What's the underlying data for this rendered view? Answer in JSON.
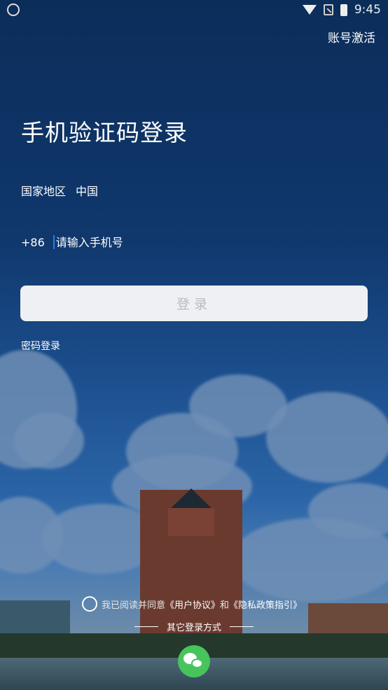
{
  "status_bar": {
    "time": "9:45"
  },
  "header": {
    "activate_label": "账号激活"
  },
  "main": {
    "title": "手机验证码登录",
    "region_label": "国家地区",
    "region_value": "中国",
    "country_code": "+86",
    "phone_placeholder": "请输入手机号",
    "login_button_label": "登录",
    "password_login_label": "密码登录"
  },
  "footer": {
    "agreement_prefix": "我已阅读并同意",
    "user_agreement": "《用户协议》",
    "and_text": "和",
    "privacy_policy": "《隐私政策指引》",
    "other_login_label": "其它登录方式"
  },
  "colors": {
    "wechat": "#47c45b",
    "button_bg": "#eef0f3",
    "button_text": "#b6bcc4"
  }
}
